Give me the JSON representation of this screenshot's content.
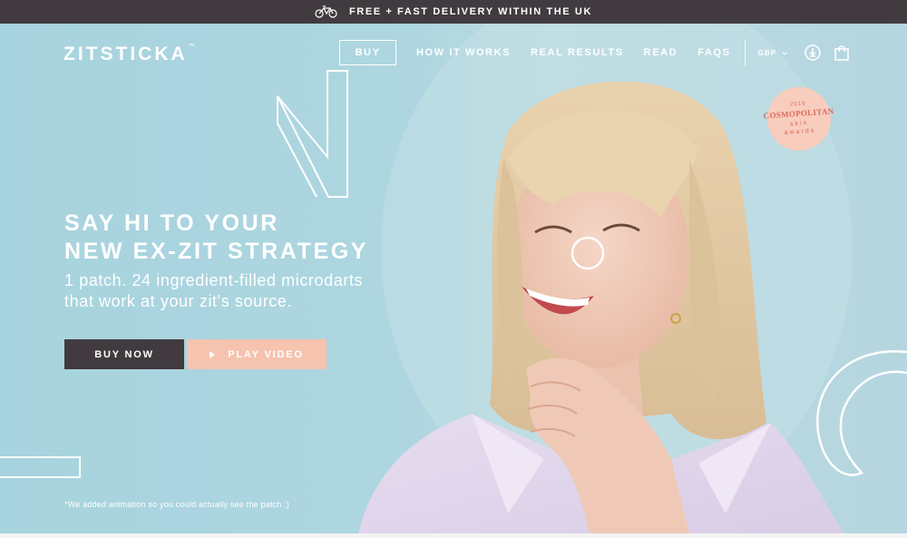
{
  "promo_bar": {
    "icon": "bicycle-icon",
    "text": "FREE + FAST DELIVERY WITHIN THE UK"
  },
  "header": {
    "logo": "ZITSTICKA",
    "logo_mark": "™",
    "nav": {
      "buy": "BUY",
      "items": [
        "HOW IT WORKS",
        "REAL RESULTS",
        "READ",
        "FAQS"
      ]
    },
    "currency": "GBP",
    "icons": [
      "account-icon",
      "shopping-bag-icon"
    ]
  },
  "hero": {
    "headline_line1": "SAY HI TO YOUR",
    "headline_line2": "NEW EX-ZIT STRATEGY",
    "sub_line1": "1 patch. 24 ingredient-filled microdarts",
    "sub_line2": "that work at your zit's source.",
    "buy_now": "BUY NOW",
    "play_video": "PLAY VIDEO",
    "note": "*We added animation so you could actually see the patch :)",
    "image": "smiling-woman-photo"
  },
  "award_badge": {
    "year": "2019",
    "magazine": "COSMOPOLITAN",
    "line1": "skin",
    "line2": "awards"
  },
  "colors": {
    "hero_bg": "#aed6e0",
    "dark": "#413b40",
    "peach": "#f6c3ae",
    "badge": "#f8cdbd"
  }
}
